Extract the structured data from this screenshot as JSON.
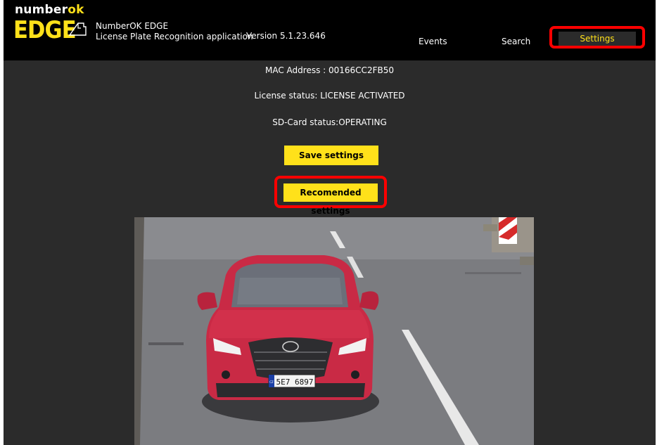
{
  "header": {
    "logo_top_white": "number",
    "logo_top_accent": "ok",
    "logo_bottom": "EDGE",
    "app_name": "NumberOK EDGE",
    "app_subtitle": "License Plate Recognition application",
    "version": "Version 5.1.23.646"
  },
  "nav": {
    "events": "Events",
    "search": "Search",
    "settings": "Settings",
    "active": "settings"
  },
  "status": {
    "mac": "MAC Address : 00166CC2FB50",
    "license": "License status: LICENSE ACTIVATED",
    "sdcard": "SD-Card status:OPERATING"
  },
  "actions": {
    "save_label": "Save settings",
    "recommended_label": "Recomended settings"
  },
  "camera": {
    "plate_prefix": "CZ",
    "plate_text": "5E7 6897"
  },
  "colors": {
    "accent": "#ffe11a",
    "highlight": "#ff0000",
    "background": "#2b2b2b",
    "header": "#000000"
  },
  "icons": {
    "logo_mark": "hand-pointer-icon"
  }
}
